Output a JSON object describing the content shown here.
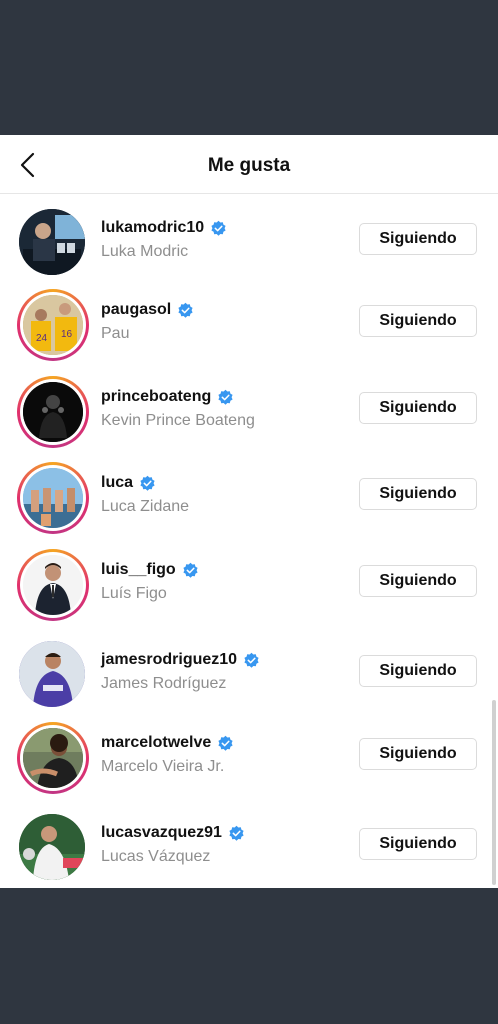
{
  "header": {
    "title": "Me gusta"
  },
  "follow_label": "Siguiendo",
  "users": [
    {
      "username": "lukamodric10",
      "name": "Luka Modric",
      "verified": true,
      "story_ring": false
    },
    {
      "username": "paugasol",
      "name": "Pau",
      "verified": true,
      "story_ring": true
    },
    {
      "username": "princeboateng",
      "name": "Kevin Prince Boateng",
      "verified": true,
      "story_ring": true
    },
    {
      "username": "luca",
      "name": "Luca Zidane",
      "verified": true,
      "story_ring": true
    },
    {
      "username": "luis__figo",
      "name": "Luís Figo",
      "verified": true,
      "story_ring": true
    },
    {
      "username": "jamesrodriguez10",
      "name": "James Rodríguez",
      "verified": true,
      "story_ring": false
    },
    {
      "username": "marcelotwelve",
      "name": "Marcelo Vieira Jr.",
      "verified": true,
      "story_ring": true
    },
    {
      "username": "lucasvazquez91",
      "name": "Lucas Vázquez",
      "verified": true,
      "story_ring": false
    }
  ],
  "colors": {
    "verified_blue": "#3897f0",
    "ring_start": "#f5a623",
    "ring_end": "#c13584",
    "backdrop": "#2f3640"
  }
}
